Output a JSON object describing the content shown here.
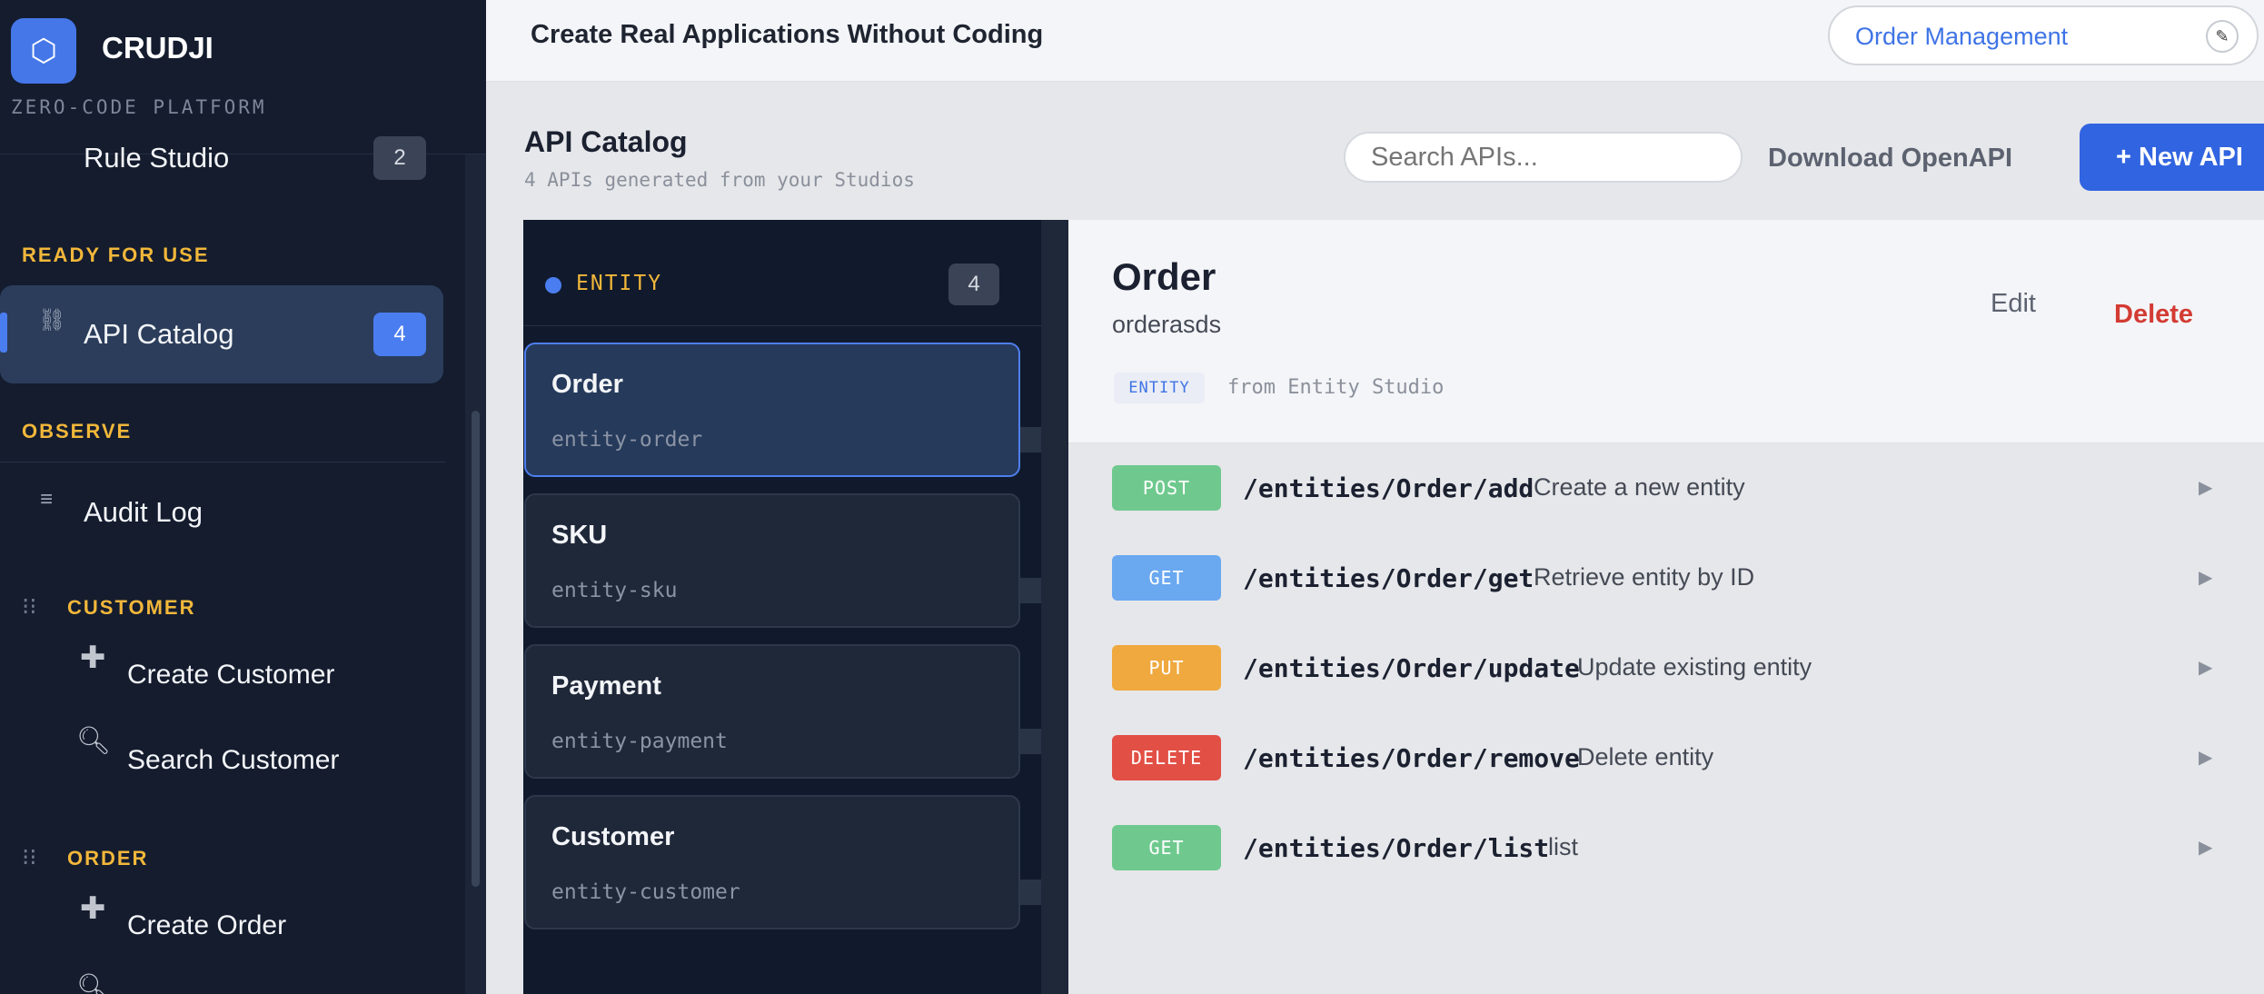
{
  "brand": {
    "name": "CRUDJI",
    "subtitle": "ZERO-CODE PLATFORM",
    "logo_icon": "hexagon-icon"
  },
  "sidebar": {
    "partial_item": {
      "label": "Rule Studio",
      "count": "2"
    },
    "sections": {
      "ready": "READY FOR USE",
      "observe": "OBSERVE"
    },
    "api_catalog": {
      "label": "API Catalog",
      "count": "4",
      "icon": "link-icon"
    },
    "audit_log": {
      "label": "Audit Log",
      "icon": "list-icon"
    },
    "groups": [
      {
        "title": "CUSTOMER",
        "items": [
          {
            "label": "Create Customer",
            "icon": "plus-icon"
          },
          {
            "label": "Search Customer",
            "icon": "magnifier-icon"
          }
        ]
      },
      {
        "title": "ORDER",
        "items": [
          {
            "label": "Create Order",
            "icon": "plus-icon"
          }
        ]
      }
    ]
  },
  "topbar": {
    "tagline": "Create Real Applications Without Coding",
    "app_selector": "Order Management"
  },
  "page": {
    "title": "API Catalog",
    "subtitle": "4 APIs generated from your Studios",
    "search_placeholder": "Search APIs...",
    "download_label": "Download OpenAPI",
    "new_label": "+ New API"
  },
  "api_group": {
    "label": "ENTITY",
    "count": "4"
  },
  "apis": [
    {
      "name": "Order",
      "slug": "entity-order",
      "active": true
    },
    {
      "name": "SKU",
      "slug": "entity-sku",
      "active": false
    },
    {
      "name": "Payment",
      "slug": "entity-payment",
      "active": false
    },
    {
      "name": "Customer",
      "slug": "entity-customer",
      "active": false
    }
  ],
  "detail": {
    "title": "Order",
    "subtitle": "orderasds",
    "edit_label": "Edit",
    "delete_label": "Delete",
    "badge": "ENTITY",
    "origin": "from Entity Studio",
    "endpoints": [
      {
        "method": "POST",
        "color": "#6fc98e",
        "path": "/entities/Order/add",
        "desc": "Create a new entity"
      },
      {
        "method": "GET",
        "color": "#6aa8f0",
        "path": "/entities/Order/get",
        "desc": "Retrieve entity by ID"
      },
      {
        "method": "PUT",
        "color": "#efa93f",
        "path": "/entities/Order/update",
        "desc": "Update existing entity"
      },
      {
        "method": "DELETE",
        "color": "#e24f45",
        "path": "/entities/Order/remove",
        "desc": "Delete entity"
      },
      {
        "method": "GET",
        "color": "#6fc98e",
        "path": "/entities/Order/list",
        "desc": "list"
      }
    ]
  }
}
